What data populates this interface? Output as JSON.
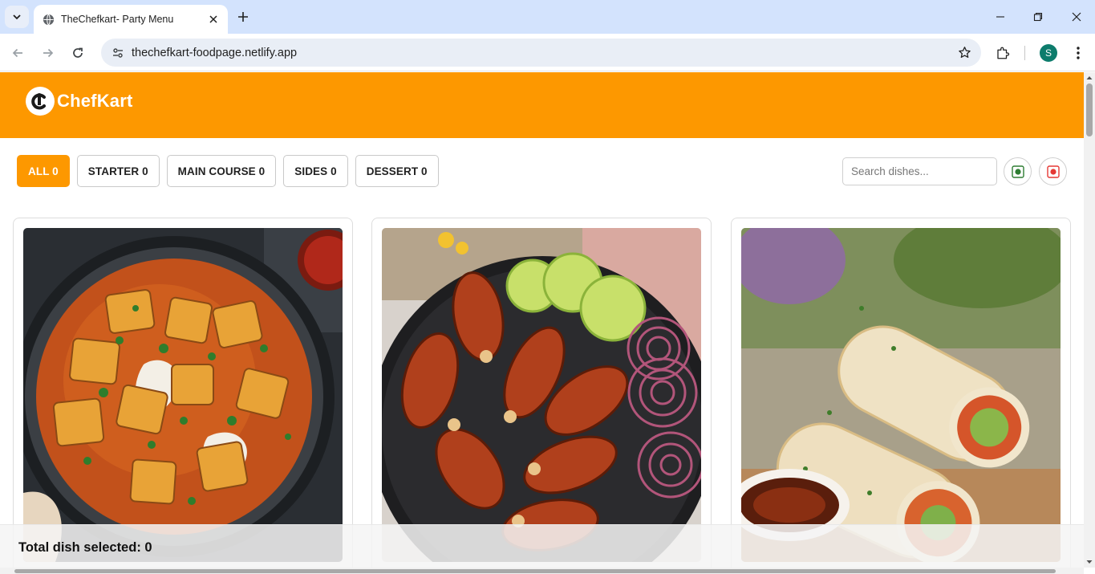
{
  "browser": {
    "tab_title": "TheChefkart- Party Menu",
    "url": "thechefkart-foodpage.netlify.app",
    "profile_initial": "S"
  },
  "site": {
    "brand": "ChefKart",
    "brand_color": "#fd9800"
  },
  "filters": [
    {
      "label": "ALL 0",
      "active": true
    },
    {
      "label": "STARTER 0",
      "active": false
    },
    {
      "label": "MAIN COURSE 0",
      "active": false
    },
    {
      "label": "SIDES 0",
      "active": false
    },
    {
      "label": "DESSERT 0",
      "active": false
    }
  ],
  "search": {
    "placeholder": "Search dishes..."
  },
  "diet_toggles": [
    {
      "icon": "veg-icon",
      "color": "#2e7d32"
    },
    {
      "icon": "non-veg-icon",
      "color": "#e53935"
    }
  ],
  "dishes": [
    {
      "image": "paneer-curry-image"
    },
    {
      "image": "tandoori-chicken-image"
    },
    {
      "image": "spring-rolls-image"
    }
  ],
  "footer": {
    "total_label": "Total dish selected: 0"
  }
}
